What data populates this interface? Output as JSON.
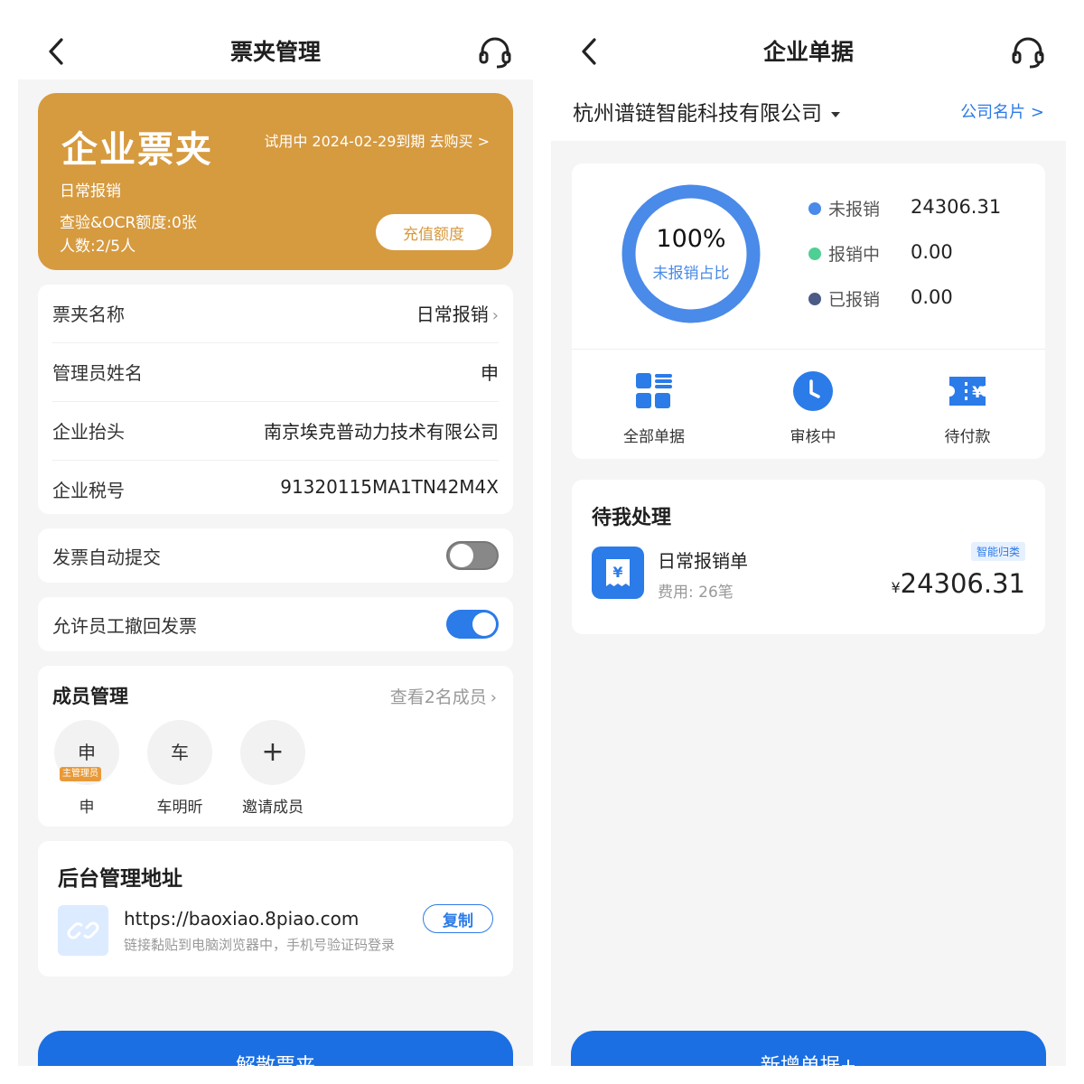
{
  "left": {
    "title": "票夹管理",
    "card": {
      "big_title": "企业票夹",
      "trial_text": "试用中 2024-02-29到期 去购买 >",
      "line1": "日常报销",
      "line2": "查验&OCR额度:0张",
      "line3": "人数:2/5人",
      "recharge_label": "充值额度"
    },
    "info": {
      "name_k": "票夹名称",
      "name_v": "日常报销",
      "admin_k": "管理员姓名",
      "admin_v": "申",
      "header_k": "企业抬头",
      "header_v": "南京埃克普动力技术有限公司",
      "tax_k": "企业税号",
      "tax_v": "91320115MA1TN42M4X"
    },
    "toggles": {
      "auto_submit": "发票自动提交",
      "allow_recall": "允许员工撤回发票"
    },
    "members": {
      "title": "成员管理",
      "link": "查看2名成员",
      "m1_avatar": "申",
      "m1_badge": "主管理员",
      "m1_name": "申",
      "m2_avatar": "车",
      "m2_name": "车明昕",
      "invite_symbol": "+",
      "invite_label": "邀请成员"
    },
    "admin": {
      "title": "后台管理地址",
      "url": "https://baoxiao.8piao.com",
      "tip": "链接黏贴到电脑浏览器中，手机号验证码登录",
      "copy_label": "复制"
    },
    "bottom_button": "解散票夹"
  },
  "right": {
    "title": "企业单据",
    "company": "杭州谱链智能科技有限公司",
    "company_card_link": "公司名片 >",
    "donut": {
      "percent": "100%",
      "label": "未报销占比"
    },
    "legend": [
      {
        "label": "未报销",
        "value": "24306.31",
        "color": "#4a8ae8"
      },
      {
        "label": "报销中",
        "value": "0.00",
        "color": "#4fcf94"
      },
      {
        "label": "已报销",
        "value": "0.00",
        "color": "#4a5b85"
      }
    ],
    "quick_actions": [
      "全部单据",
      "审核中",
      "待付款"
    ],
    "todo": {
      "title": "待我处理",
      "item_name": "日常报销单",
      "item_sub": "费用: 26笔",
      "tag": "智能归类",
      "amount_symbol": "¥",
      "amount": "24306.31"
    },
    "bottom_button": "新增单据+"
  },
  "colors": {
    "accent": "#2b7be8",
    "orange": "#d69a3f"
  }
}
